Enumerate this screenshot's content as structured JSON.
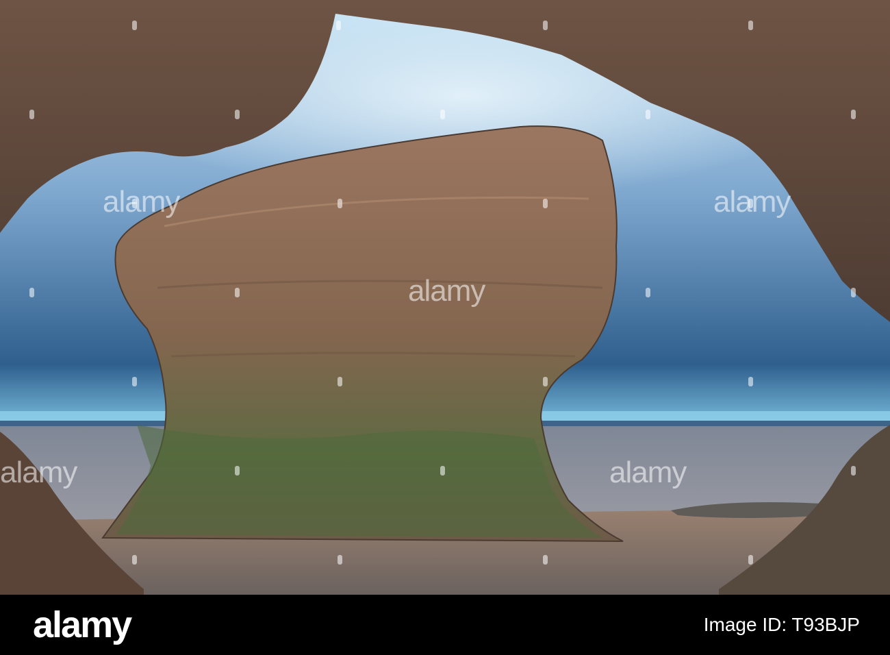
{
  "photo": {
    "watermark_text": "alamy",
    "sky_top": "#9ec9e8",
    "sky_bottom": "#3a6e9c",
    "sea_color": "#8a94a3",
    "rock_color": "#8a6a55"
  },
  "footer": {
    "logo_text": "alamy",
    "image_id_text": "Image ID: T93BJP"
  }
}
